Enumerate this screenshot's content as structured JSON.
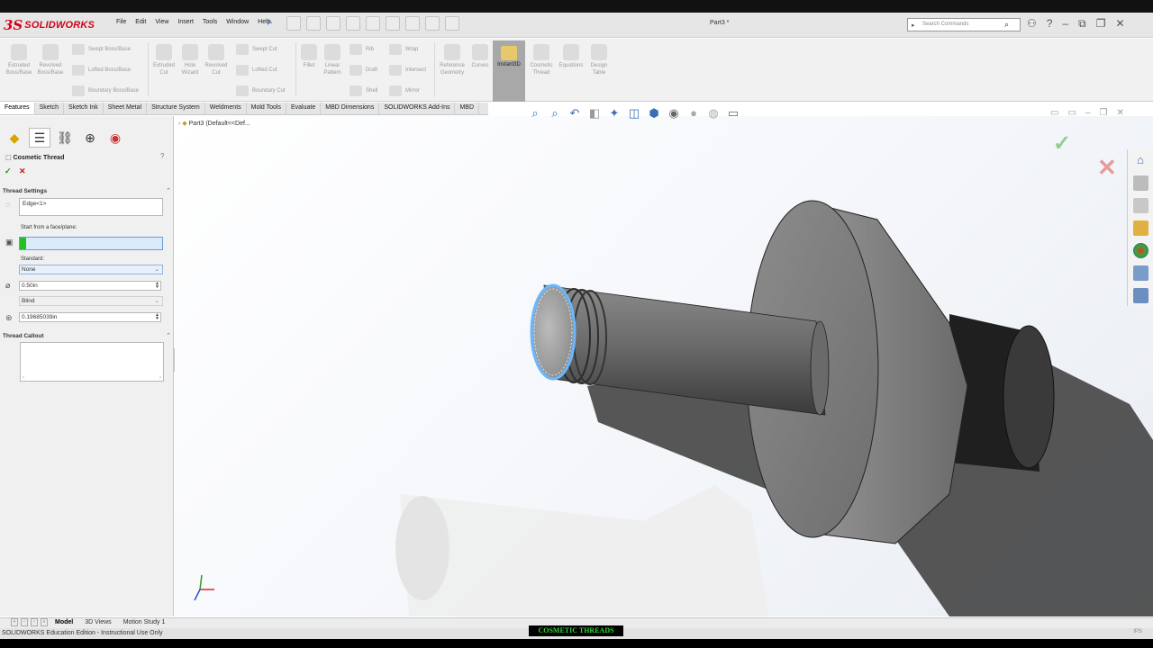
{
  "app": {
    "brand_prefix": "3S",
    "brand": "SOLIDWORKS",
    "doc_title": "Part3 *"
  },
  "menu": [
    "File",
    "Edit",
    "View",
    "Insert",
    "Tools",
    "Window",
    "Help"
  ],
  "search": {
    "placeholder": "Search Commands"
  },
  "commands": {
    "extruded_boss": "Extruded Boss/Base",
    "revolved_boss": "Revolved Boss/Base",
    "swept_boss": "Swept Boss/Base",
    "lofted_boss": "Lofted Boss/Base",
    "boundary_boss": "Boundary Boss/Base",
    "extruded_cut": "Extruded Cut",
    "hole_wizard": "Hole Wizard",
    "revolved_cut": "Revolved Cut",
    "swept_cut": "Swept Cut",
    "lofted_cut": "Lofted Cut",
    "boundary_cut": "Boundary Cut",
    "fillet": "Fillet",
    "linear_pattern": "Linear Pattern",
    "rib": "Rib",
    "draft": "Draft",
    "shell": "Shell",
    "wrap": "Wrap",
    "intersect": "Intersect",
    "mirror": "Mirror",
    "reference_geometry": "Reference Geometry",
    "curves": "Curves",
    "instant3d": "Instant3D",
    "cosmetic_thread": "Cosmetic Thread",
    "equations": "Equations",
    "design_table": "Design Table"
  },
  "tabs": [
    "Features",
    "Sketch",
    "Sketch Ink",
    "Sheet Metal",
    "Structure System",
    "Weldments",
    "Mold Tools",
    "Evaluate",
    "MBD Dimensions",
    "SOLIDWORKS Add-Ins",
    "MBD"
  ],
  "active_tab": "Features",
  "property_manager": {
    "title": "Cosmetic Thread",
    "help": "?",
    "ok": "✓",
    "cancel": "✕",
    "thread_settings": {
      "header": "Thread Settings",
      "edge": "Edge<1>",
      "start_label": "Start from a face/plane:",
      "standard_label": "Standard:",
      "standard_value": "None",
      "diameter": "0.50in",
      "end_condition": "Blind",
      "depth": "0.19685039in"
    },
    "thread_callout": {
      "header": "Thread Callout"
    }
  },
  "tree": {
    "part": "Part3",
    "config": "(Default<<Def..."
  },
  "bottom_tabs": [
    "Model",
    "3D Views",
    "Motion Study 1"
  ],
  "active_bottom_tab": "Model",
  "status": "SOLIDWORKS Education Edition - Instructional Use Only",
  "status_units": "IPS",
  "caption": "COSMETIC THREADS",
  "colors": {
    "accent": "#3b6fb3",
    "brand": "#d0021b",
    "ok": "#1a9a1a",
    "cancel": "#c01818",
    "caption": "#37d437"
  }
}
